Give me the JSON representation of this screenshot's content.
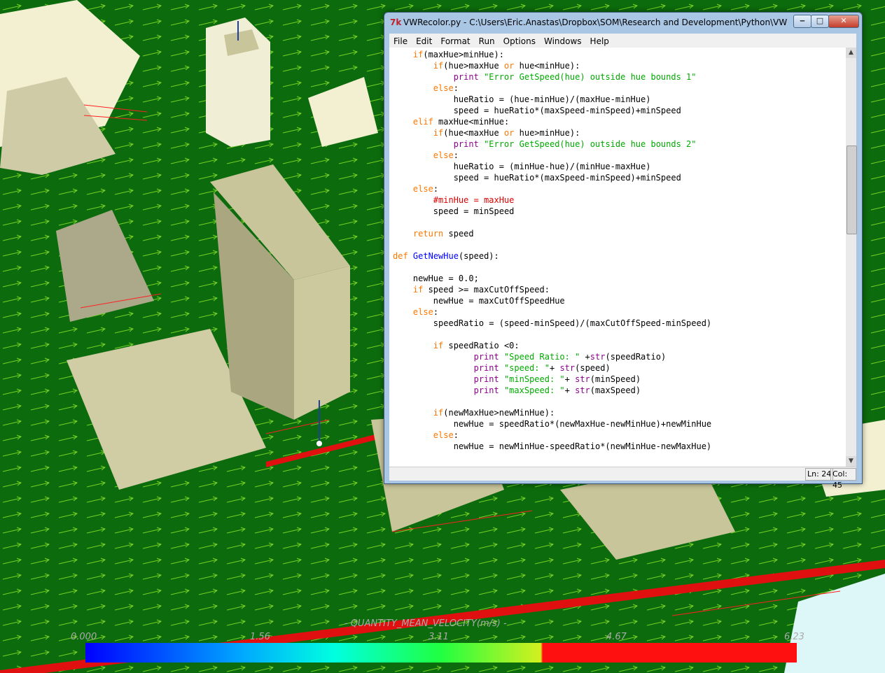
{
  "window": {
    "title": "VWRecolor.py - C:\\Users\\Eric.Anastas\\Dropbox\\SOM\\Research and Development\\Python\\VWRecolor...",
    "icon": "idle-tk-icon",
    "minimize": "minimize-icon",
    "maximize": "maximize-icon",
    "close": "close-icon"
  },
  "menu": [
    "File",
    "Edit",
    "Format",
    "Run",
    "Options",
    "Windows",
    "Help"
  ],
  "status": {
    "line": "Ln: 24",
    "col": "Col: 45"
  },
  "legend": {
    "title": "- QUANTITY_MEAN_VELOCITY(m/s) -",
    "ticks": [
      "0.000",
      "1.56",
      "3.11",
      "4.67",
      "6.23"
    ]
  },
  "code": [
    "    if(maxHue>minHue):",
    "        if(hue>maxHue or hue<minHue):",
    "            print \"Error GetSpeed(hue) outside hue bounds 1\"",
    "        else:",
    "            hueRatio = (hue-minHue)/(maxHue-minHue)",
    "            speed = hueRatio*(maxSpeed-minSpeed)+minSpeed",
    "    elif maxHue<minHue:",
    "        if(hue<maxHue or hue>minHue):",
    "            print \"Error GetSpeed(hue) outside hue bounds 2\"",
    "        else:",
    "            hueRatio = (minHue-hue)/(minHue-maxHue)",
    "            speed = hueRatio*(maxSpeed-minSpeed)+minSpeed",
    "    else:",
    "        #minHue = maxHue",
    "        speed = minSpeed",
    "",
    "    return speed",
    "",
    "def GetNewHue(speed):",
    "",
    "    newHue = 0.0;",
    "    if speed >= maxCutOffSpeed:",
    "        newHue = maxCutOffSpeedHue",
    "    else:",
    "        speedRatio = (speed-minSpeed)/(maxCutOffSpeed-minSpeed)",
    "",
    "        if speedRatio <0:",
    "                print \"Speed Ratio: \" +str(speedRatio)",
    "                print \"speed: \"+ str(speed)",
    "                print \"minSpeed: \"+ str(minSpeed)",
    "                print \"maxSpeed: \"+ str(maxSpeed)",
    "",
    "        if(newMaxHue>newMinHue):",
    "            newHue = speedRatio*(newMaxHue-newMinHue)+newMinHue",
    "        else:",
    "            newHue = newMinHue-speedRatio*(newMinHue-newMaxHue)"
  ],
  "colors": {
    "ground": "#0c6b0c",
    "building": "#c9c59a",
    "road": "#e01010",
    "window_frame": "#a9c6e4"
  }
}
